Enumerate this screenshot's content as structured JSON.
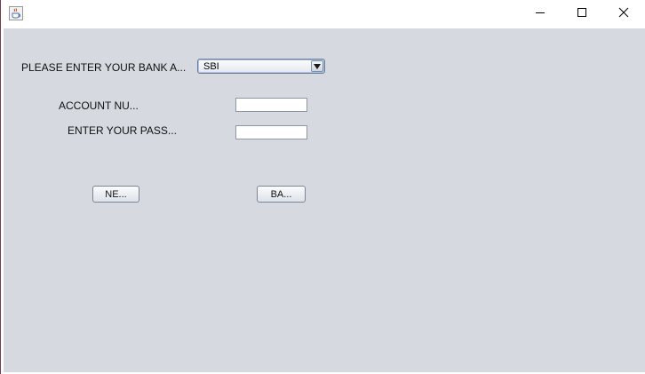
{
  "window": {
    "icon": "java-coffee-cup-icon",
    "controls": [
      "minimize-icon",
      "maximize-icon",
      "close-icon"
    ]
  },
  "form": {
    "bank_label": "PLEASE ENTER YOUR BANK A...",
    "bank_selected": "SBI",
    "account_label": "ACCOUNT NU...",
    "account_value": "",
    "password_label": "ENTER YOUR PASS...",
    "password_value": "",
    "next_button": "NE...",
    "back_button": "BA..."
  },
  "colors": {
    "content_bg": "#d6d9e0",
    "titlebar_bg": "#ffffff"
  }
}
